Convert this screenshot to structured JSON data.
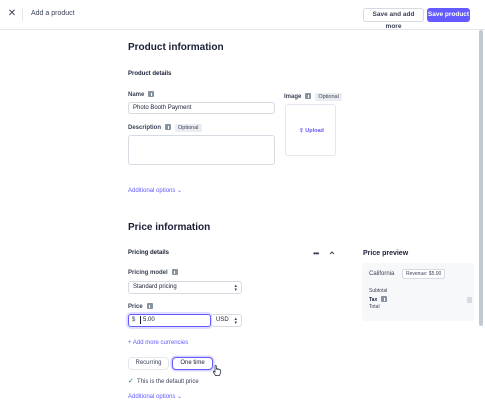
{
  "header": {
    "close_icon": "close-icon",
    "title": "Add a product",
    "save_and_add_more": "Save and add more",
    "save_product": "Save product"
  },
  "product_information": {
    "heading": "Product information",
    "details_heading": "Product details",
    "name_label": "Name",
    "name_value": "Photo Booth Payment",
    "description_label": "Description",
    "description_optional": "Optional",
    "description_value": "",
    "image_label": "Image",
    "image_optional": "Optional",
    "upload_label": "Upload",
    "additional_options": "Additional options"
  },
  "price_information": {
    "heading": "Price information",
    "pricing_details": "Pricing details",
    "pricing_model_label": "Pricing model",
    "pricing_model_value": "Standard pricing",
    "price_label": "Price",
    "currency_symbol": "$",
    "price_value": "5.00",
    "currency_value": "USD",
    "add_more_currencies": "Add more currencies",
    "recurring_label": "Recurring",
    "one_time_label": "One time",
    "selected_type": "One time",
    "default_price_text": "This is the default price",
    "additional_options": "Additional options"
  },
  "price_preview": {
    "heading": "Price preview",
    "location": "California",
    "revenue_badge": "Revenue: $5.00",
    "subtotal_label": "Subtotal",
    "tax_label": "Tax",
    "total_label": "Total"
  },
  "colors": {
    "accent": "#635bff",
    "success": "#09825d",
    "text": "#1a1f36",
    "border": "#d5dbe1"
  }
}
